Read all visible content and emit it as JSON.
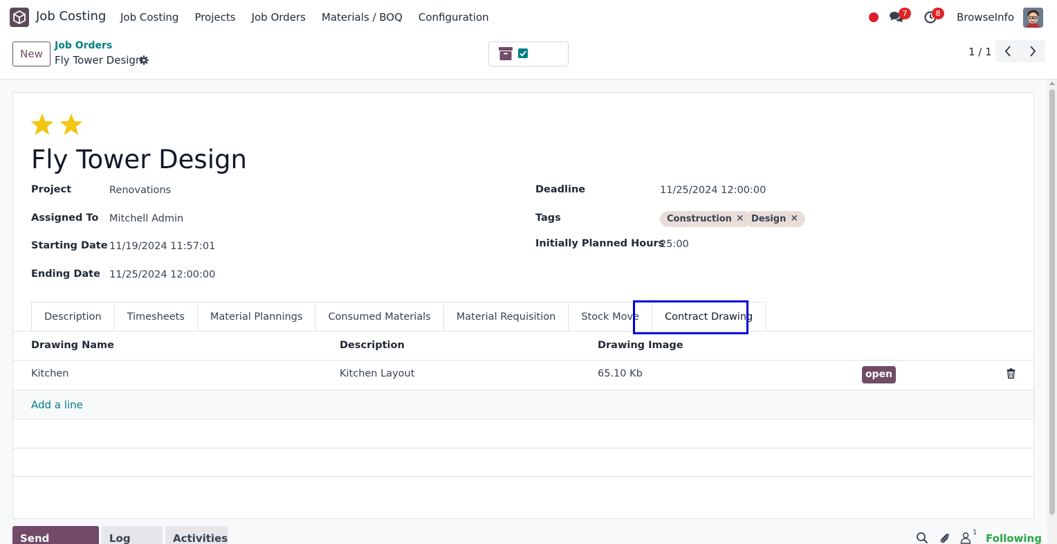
{
  "navbar": {
    "app_name": "Job Costing",
    "menu": [
      "Job Costing",
      "Projects",
      "Job Orders",
      "Materials / BOQ",
      "Configuration"
    ],
    "messages_count": "7",
    "activities_count": "8",
    "user_name": "BrowseInfo",
    "record_dot_color": "#e11d2a"
  },
  "control_panel": {
    "new_label": "New",
    "breadcrumb_parent": "Job Orders",
    "breadcrumb_current": "Fly Tower Design",
    "pager_text": "1 / 1"
  },
  "record": {
    "stars": 2,
    "title": "Fly Tower Design",
    "fields_left": [
      {
        "label": "Project",
        "value": "Renovations"
      },
      {
        "label": "Assigned To",
        "value": "Mitchell Admin"
      },
      {
        "label": "Starting Date",
        "value": "11/19/2024 11:57:01"
      },
      {
        "label": "Ending Date",
        "value": "11/25/2024 12:00:00"
      }
    ],
    "deadline": {
      "label": "Deadline",
      "value": "11/25/2024 12:00:00"
    },
    "tags_label": "Tags",
    "tags": [
      "Construction",
      "Design"
    ],
    "planned_hours": {
      "label": "Initially Planned Hours",
      "value": "25:00"
    }
  },
  "tabs": [
    "Description",
    "Timesheets",
    "Material Plannings",
    "Consumed Materials",
    "Material Requisition",
    "Stock Move",
    "Contract Drawing"
  ],
  "active_tab": "Contract Drawing",
  "table": {
    "columns": [
      "Drawing Name",
      "Description",
      "Drawing Image"
    ],
    "rows": [
      {
        "name": "Kitchen",
        "description": "Kitchen Layout",
        "image_size": "65.10 Kb",
        "status": "open"
      }
    ],
    "add_line": "Add a line"
  },
  "chatter": {
    "send_message": "Send message",
    "log_note": "Log note",
    "activities": "Activities",
    "followers_count": "1",
    "following": "Following"
  },
  "colors": {
    "brand": "#714b67",
    "link": "#017e84",
    "star": "#f3c614",
    "highlight": "#0000dd",
    "following": "#28a745"
  }
}
